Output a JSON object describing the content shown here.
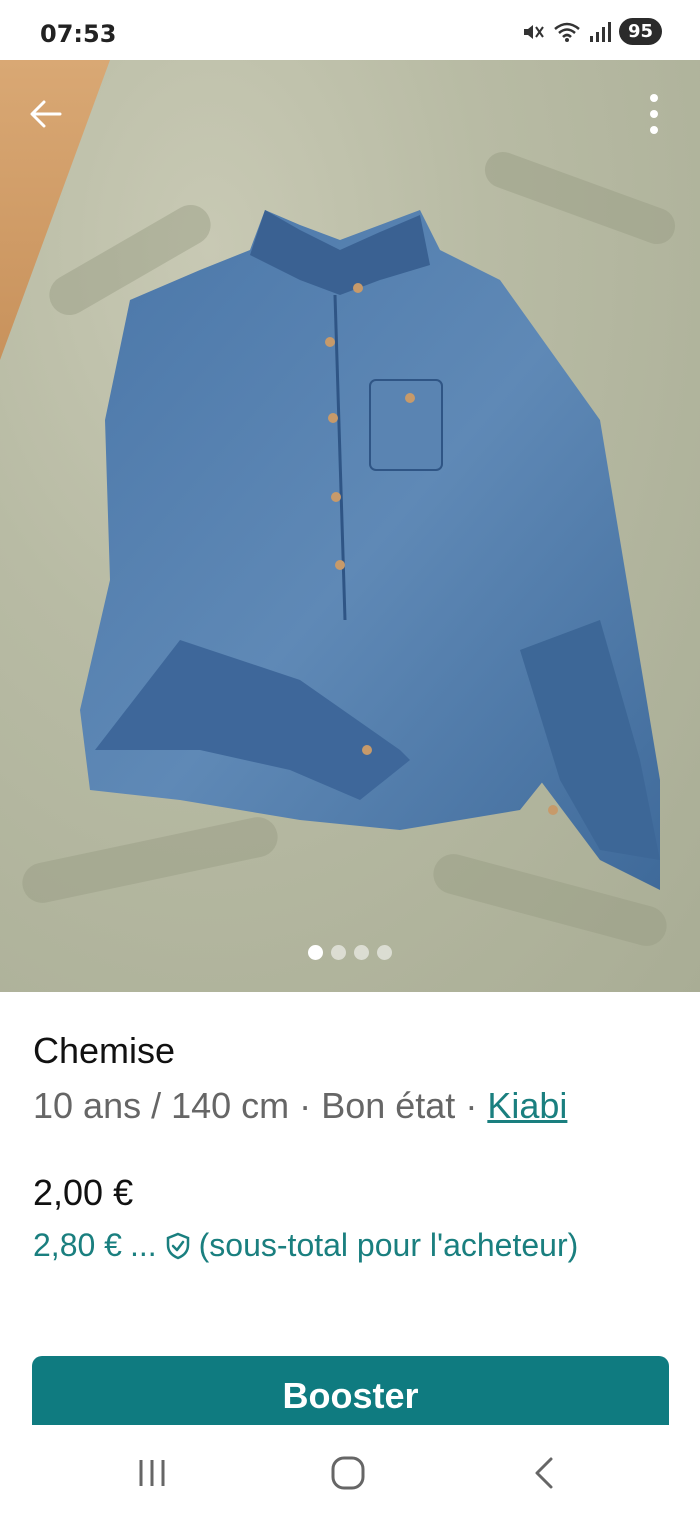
{
  "status_bar": {
    "time": "07:53",
    "battery": "95"
  },
  "gallery": {
    "image_count": 4,
    "active_index": 0,
    "image_subject": "denim-shirt"
  },
  "product": {
    "title": "Chemise",
    "size": "10 ans / 140 cm",
    "separator1": "·",
    "condition": "Bon état",
    "separator2": "·",
    "brand": "Kiabi",
    "price": "2,00 €",
    "buyer_price": "2,80 €",
    "buyer_ellipsis": "...",
    "buyer_note": "(sous-total pour l'acheteur)"
  },
  "actions": {
    "booster_label": "Booster"
  },
  "colors": {
    "accent": "#0f7b80",
    "link": "#1a7f7f"
  }
}
